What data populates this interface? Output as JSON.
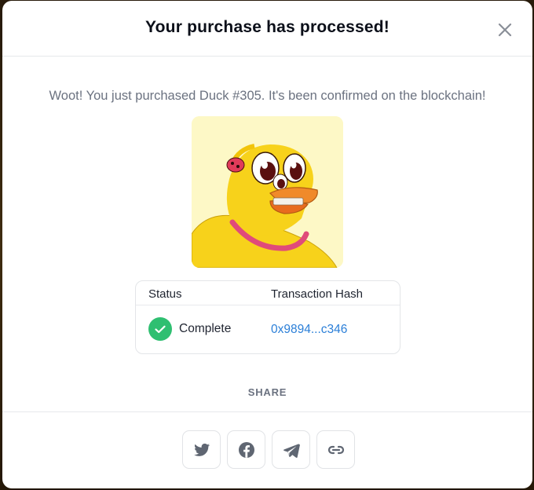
{
  "modal": {
    "title": "Your purchase has processed!",
    "message": "Woot! You just purchased Duck #305. It's been confirmed on the blockchain!"
  },
  "nft": {
    "image_alt": "Duck #305",
    "background_color": "#fdf8c6"
  },
  "transaction": {
    "status_header": "Status",
    "hash_header": "Transaction Hash",
    "status_value": "Complete",
    "hash_value": "0x9894...c346",
    "status_color": "#2fbf71",
    "link_color": "#2b7fd8"
  },
  "share": {
    "label": "SHARE",
    "buttons": [
      {
        "icon": "twitter-icon"
      },
      {
        "icon": "facebook-icon"
      },
      {
        "icon": "telegram-icon"
      },
      {
        "icon": "link-icon"
      }
    ]
  }
}
